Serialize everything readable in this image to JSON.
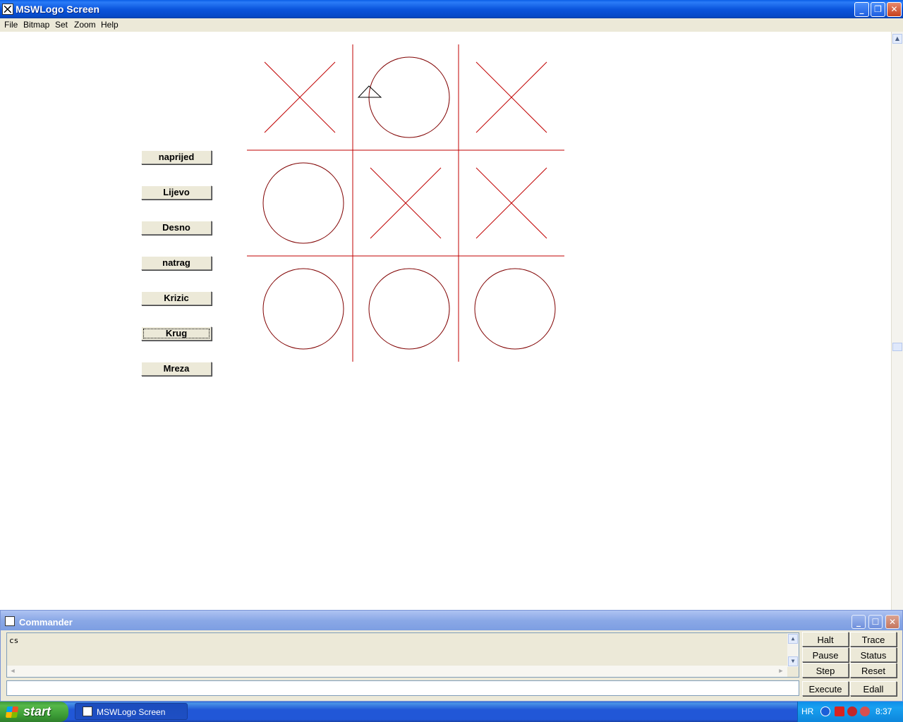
{
  "window": {
    "title": "MSWLogo Screen"
  },
  "menu": [
    "File",
    "Bitmap",
    "Set",
    "Zoom",
    "Help"
  ],
  "buttons": [
    "naprijed",
    "Lijevo",
    "Desno",
    "natrag",
    "Krizic",
    "Krug",
    "Mreza"
  ],
  "focused_button": "Krug",
  "board": {
    "cells": [
      [
        "X",
        "O",
        "X"
      ],
      [
        "O",
        "X",
        "X"
      ],
      [
        "O",
        "O",
        "O"
      ]
    ],
    "line_color": "#c00000",
    "circle_color": "#800000"
  },
  "commander": {
    "title": "Commander",
    "history": "cs",
    "input": "",
    "buttons": {
      "halt": "Halt",
      "trace": "Trace",
      "pause": "Pause",
      "status": "Status",
      "step": "Step",
      "reset": "Reset",
      "execute": "Execute",
      "edall": "Edall"
    }
  },
  "taskbar": {
    "start": "start",
    "task": "MSWLogo Screen",
    "lang": "HR",
    "clock": "8:37"
  }
}
